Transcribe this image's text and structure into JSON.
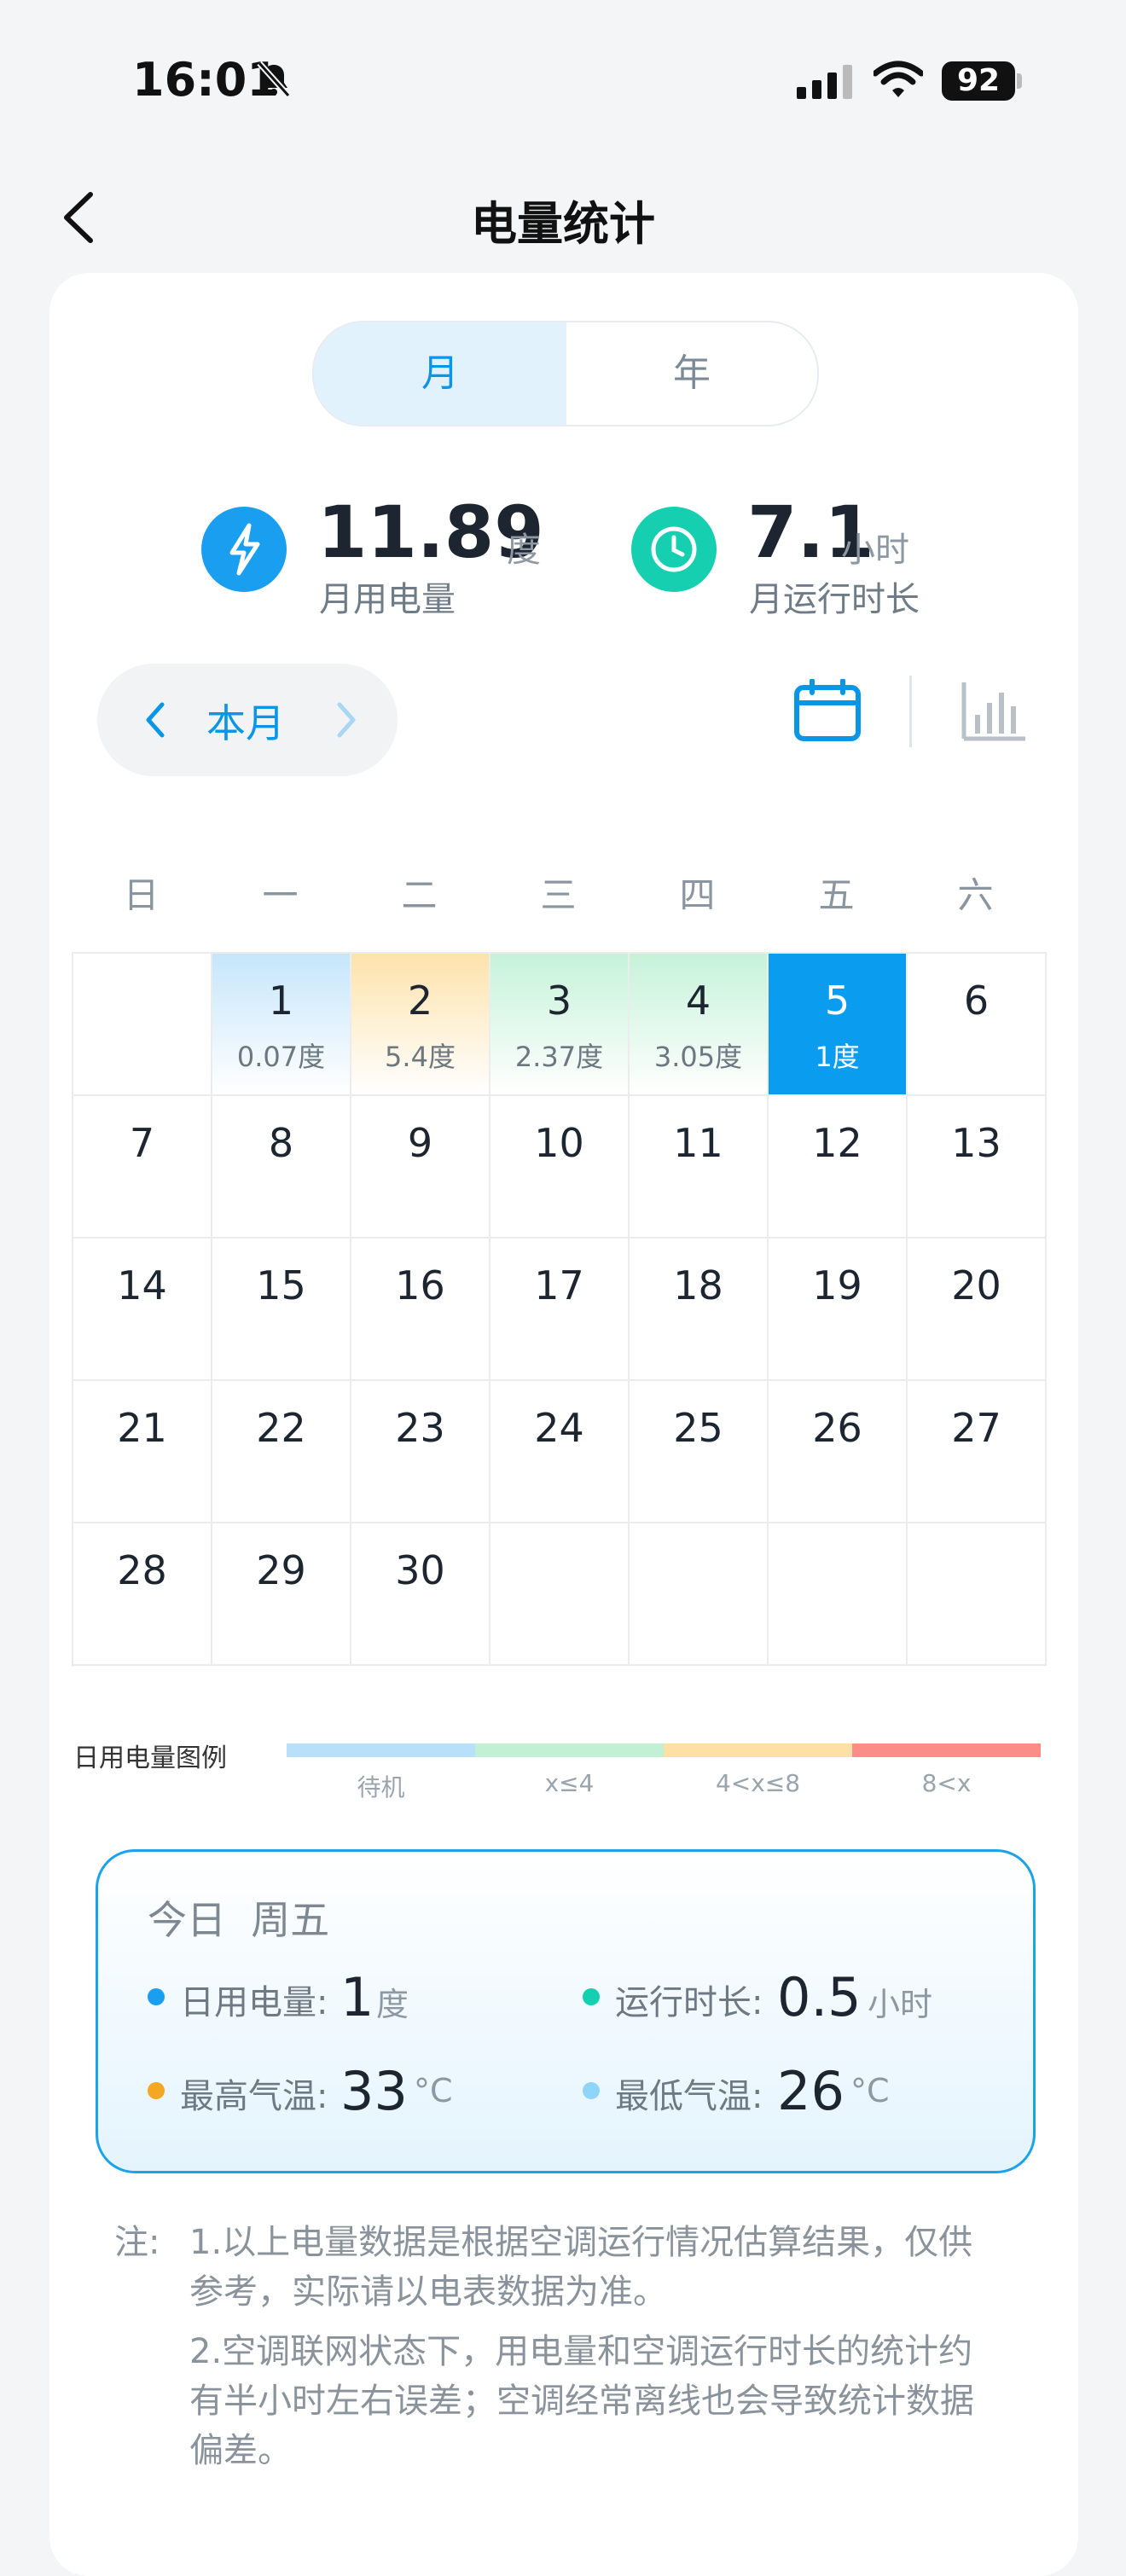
{
  "status_bar": {
    "time": "16:01",
    "battery": "92"
  },
  "header": {
    "title": "电量统计"
  },
  "segmented": {
    "month": "月",
    "year": "年",
    "selected": "月"
  },
  "summary": {
    "power_value": "11.89",
    "power_unit": "度",
    "power_label": "月用电量",
    "runtime_value": "7.1",
    "runtime_unit": "小时",
    "runtime_label": "月运行时长"
  },
  "month_nav": {
    "label": "本月"
  },
  "weekdays": [
    "日",
    "一",
    "二",
    "三",
    "四",
    "五",
    "六"
  ],
  "calendar": {
    "days": [
      {
        "day": "1",
        "value": "0.07度"
      },
      {
        "day": "2",
        "value": "5.4度"
      },
      {
        "day": "3",
        "value": "2.37度"
      },
      {
        "day": "4",
        "value": "3.05度"
      },
      {
        "day": "5",
        "value": "1度"
      },
      {
        "day": "6"
      },
      {
        "day": "7"
      },
      {
        "day": "8"
      },
      {
        "day": "9"
      },
      {
        "day": "10"
      },
      {
        "day": "11"
      },
      {
        "day": "12"
      },
      {
        "day": "13"
      },
      {
        "day": "14"
      },
      {
        "day": "15"
      },
      {
        "day": "16"
      },
      {
        "day": "17"
      },
      {
        "day": "18"
      },
      {
        "day": "19"
      },
      {
        "day": "20"
      },
      {
        "day": "21"
      },
      {
        "day": "22"
      },
      {
        "day": "23"
      },
      {
        "day": "24"
      },
      {
        "day": "25"
      },
      {
        "day": "26"
      },
      {
        "day": "27"
      },
      {
        "day": "28"
      },
      {
        "day": "29"
      },
      {
        "day": "30"
      }
    ]
  },
  "legend": {
    "title": "日用电量图例",
    "items": [
      {
        "label": "待机",
        "color": "#b9e0fa"
      },
      {
        "label": "x≤4",
        "color": "#c2f0d5"
      },
      {
        "label": "4<x≤8",
        "color": "#fde0a6"
      },
      {
        "label": "8<x",
        "color": "#fb8c86"
      }
    ]
  },
  "today": {
    "title": "今日  周五",
    "power_label": "日用电量:",
    "power_value": "1",
    "power_unit": "度",
    "runtime_label": "运行时长:",
    "runtime_value": "0.5",
    "runtime_unit": "小时",
    "max_label": "最高气温:",
    "max_value": "33",
    "max_unit": "°C",
    "min_label": "最低气温:",
    "min_value": "26",
    "min_unit": "°C",
    "colors": {
      "power": "#1a9ff0",
      "runtime": "#16cfb0",
      "max": "#f5a623",
      "min": "#8fd4fb"
    }
  },
  "notes": {
    "prefix": "注:",
    "line1a": "1.以上电量数据是根据空调运行情况估算结果，仅供",
    "line1b": "参考，实际请以电表数据为准。",
    "line2a": "2.空调联网状态下，用电量和空调运行时长的统计约",
    "line2b": "有半小时左右误差；空调经常离线也会导致统计数据",
    "line2c": "偏差。"
  }
}
